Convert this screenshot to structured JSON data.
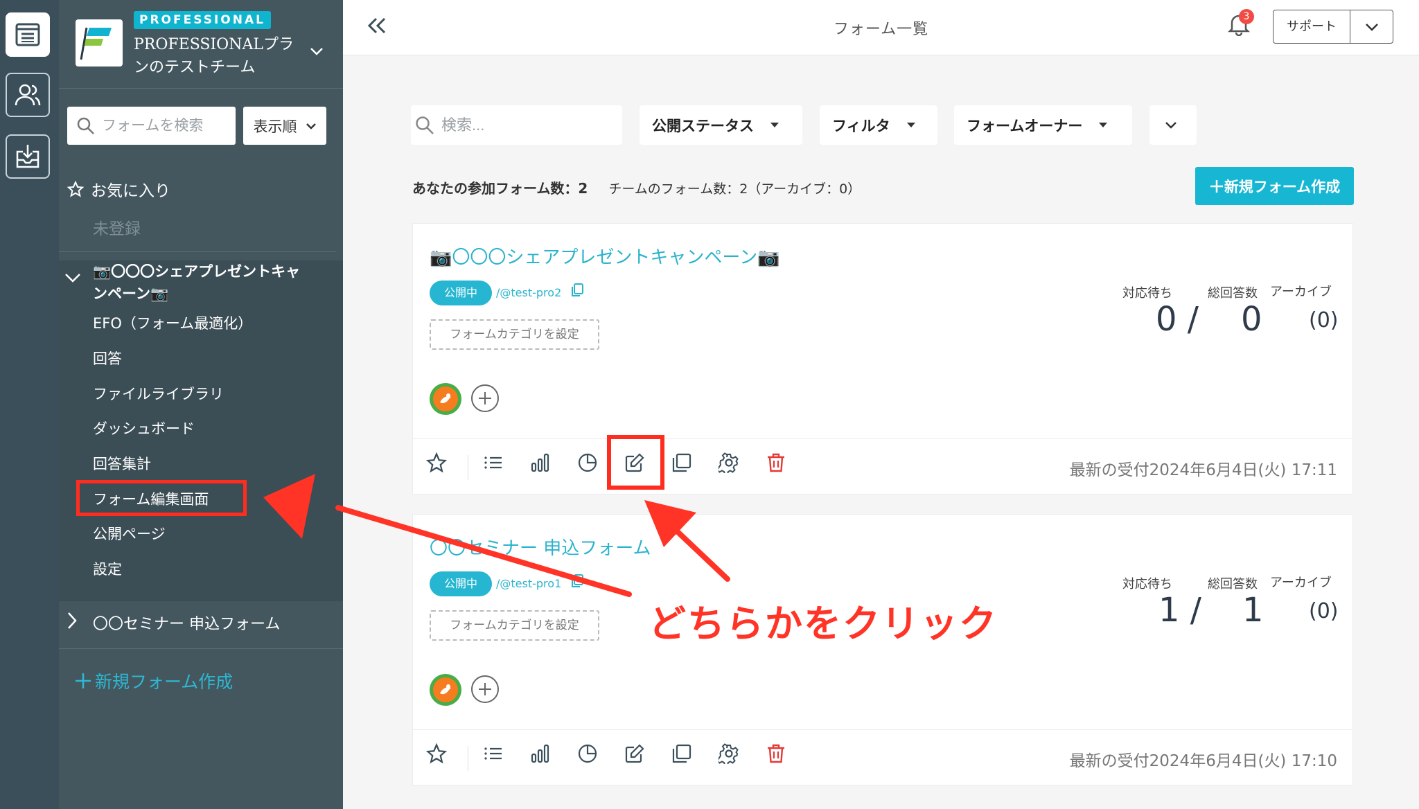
{
  "rail": {
    "icons": [
      "forms-list-icon",
      "team-members-icon",
      "inbox-download-icon"
    ]
  },
  "team": {
    "badge": "PROFESSIONAL",
    "name": "PROFESSIONALプランのテストチーム"
  },
  "sidebar": {
    "search_placeholder": "フォームを検索",
    "sort_label": "表示順",
    "favorites_label": "お気に入り",
    "favorites_empty": "未登録",
    "expanded_form": {
      "title": "📷〇〇〇シェアプレゼントキャンペーン📷",
      "items": [
        "EFO（フォーム最適化）",
        "回答",
        "ファイルライブラリ",
        "ダッシュボード",
        "回答集計",
        "フォーム編集画面",
        "公開ページ",
        "設定"
      ]
    },
    "collapsed_form_title": "〇〇セミナー 申込フォーム",
    "new_form_label": "新規フォーム作成"
  },
  "topbar": {
    "title": "フォーム一覧",
    "notification_count": "3",
    "support_label": "サポート"
  },
  "filters": {
    "search_placeholder": "検索...",
    "status_label": "公開ステータス",
    "filter_label": "フィルタ",
    "owner_label": "フォームオーナー"
  },
  "counts": {
    "mine": "あなたの参加フォーム数：2",
    "team": "チームのフォーム数：2（アーカイブ：0）"
  },
  "new_form_button": "新規フォーム作成",
  "stat_labels": {
    "pending": "対応待ち",
    "total": "総回答数",
    "archive": "アーカイブ"
  },
  "cards": [
    {
      "title": "📷〇〇〇シェアプレゼントキャンペーン📷",
      "status": "公開中",
      "slug": "/@test-pro2",
      "category_button": "フォームカテゴリを設定",
      "pending": "0 /",
      "total": "0",
      "archive": "(0)",
      "latest": "最新の受付2024年6月4日(火) 17:11"
    },
    {
      "title": "〇〇セミナー 申込フォーム",
      "status": "公開中",
      "slug": "/@test-pro1",
      "category_button": "フォームカテゴリを設定",
      "pending": "1 /",
      "total": "1",
      "archive": "(0)",
      "latest": "最新の受付2024年6月4日(火) 17:10"
    }
  ],
  "annotation": "どちらかをクリック",
  "colors": {
    "accent": "#17b7d4",
    "sidebar": "#44575f",
    "rail": "#3b4f5b",
    "highlight": "#ff2d20",
    "delete": "#e53935"
  }
}
